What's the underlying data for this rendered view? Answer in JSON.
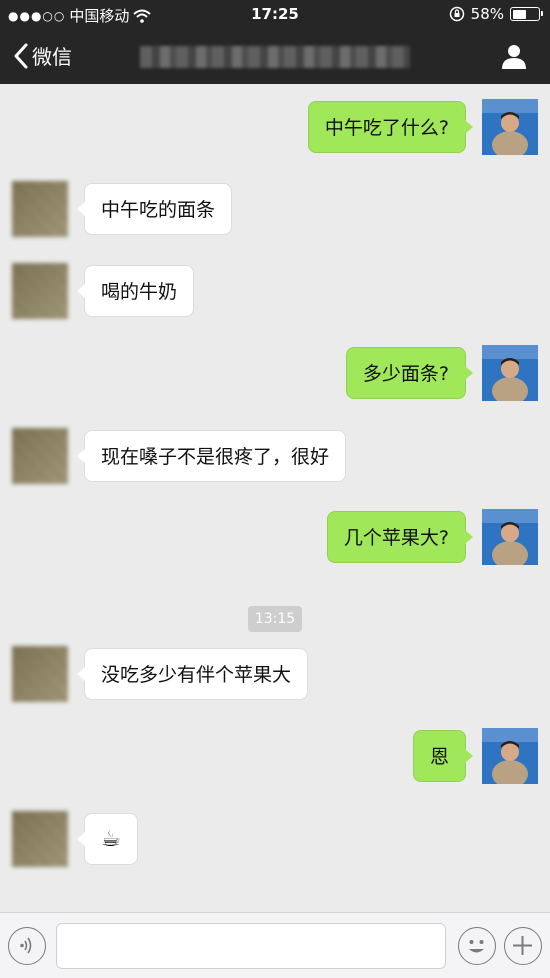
{
  "status_bar": {
    "carrier": "中国移动",
    "time": "17:25",
    "battery": "58%",
    "battery_level": 0.58
  },
  "nav": {
    "back_label": "微信"
  },
  "messages": [
    {
      "side": "me",
      "text": "中午吃了什么?"
    },
    {
      "side": "other",
      "text": "中午吃的面条"
    },
    {
      "side": "other",
      "text": "喝的牛奶"
    },
    {
      "side": "me",
      "text": "多少面条?"
    },
    {
      "side": "other",
      "text": "现在嗓子不是很疼了，很好"
    },
    {
      "side": "me",
      "text": "几个苹果大?"
    },
    {
      "side": "other",
      "text": "没吃多少有伴个苹果大"
    },
    {
      "side": "me",
      "text": "恩"
    },
    {
      "side": "other",
      "text": "☕"
    }
  ],
  "timestamp": "13:15",
  "icons": {
    "back": "chevron-left-icon",
    "profile": "person-icon",
    "voice": "voice-icon",
    "emoji": "emoji-icon",
    "plus": "plus-icon"
  },
  "colors": {
    "nav_bg": "#262626",
    "chat_bg": "#ebebeb",
    "my_bubble": "#a0e75a",
    "other_bubble": "#ffffff"
  }
}
